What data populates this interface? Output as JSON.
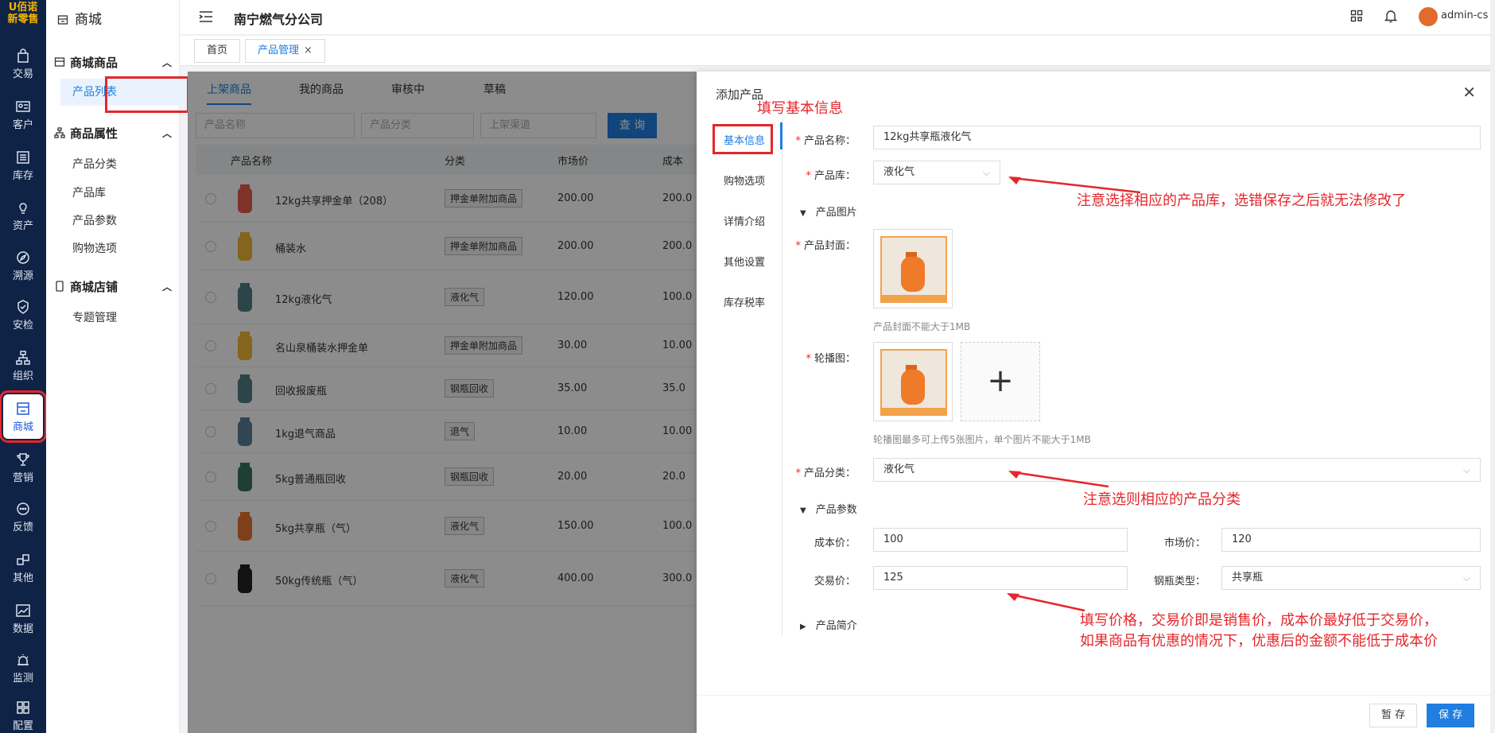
{
  "rail": {
    "logo_line1": "U佰诺",
    "logo_line2": "新零售",
    "items": [
      {
        "label": "交易",
        "icon": "bag-icon"
      },
      {
        "label": "客户",
        "icon": "id-card-icon"
      },
      {
        "label": "库存",
        "icon": "list-icon"
      },
      {
        "label": "资产",
        "icon": "bulb-icon"
      },
      {
        "label": "溯源",
        "icon": "compass-icon"
      },
      {
        "label": "安检",
        "icon": "shield-check-icon"
      },
      {
        "label": "组织",
        "icon": "org-icon"
      },
      {
        "label": "商城",
        "icon": "store-icon"
      },
      {
        "label": "营销",
        "icon": "trophy-icon"
      },
      {
        "label": "反馈",
        "icon": "chat-icon"
      },
      {
        "label": "其他",
        "icon": "blocks-icon"
      },
      {
        "label": "数据",
        "icon": "chart-icon"
      },
      {
        "label": "监测",
        "icon": "alarm-icon"
      },
      {
        "label": "配置",
        "icon": "grid-icon"
      }
    ]
  },
  "sidebar": {
    "title": "商城",
    "groups": [
      {
        "label": "商城商品",
        "items": [
          "产品列表"
        ]
      },
      {
        "label": "商品属性",
        "items": [
          "产品分类",
          "产品库",
          "产品参数",
          "购物选项"
        ]
      },
      {
        "label": "商城店铺",
        "items": [
          "专题管理"
        ]
      }
    ]
  },
  "topbar": {
    "company": "南宁燃气分公司",
    "user": "admin-cs"
  },
  "tabs": [
    {
      "label": "首页"
    },
    {
      "label": "产品管理"
    }
  ],
  "list": {
    "tabs": [
      "上架商品",
      "我的商品",
      "审核中",
      "草稿"
    ],
    "filters": {
      "name_ph": "产品名称",
      "category_ph": "产品分类",
      "channel_ph": "上架渠道",
      "query": "查 询"
    },
    "columns": [
      "产品名称",
      "分类",
      "市场价",
      "成本"
    ],
    "rows": [
      {
        "name": "12kg共享押金单（208）",
        "category": "押金单附加商品",
        "price": "200.00",
        "cost": "200.0"
      },
      {
        "name": "桶装水",
        "category": "押金单附加商品",
        "price": "200.00",
        "cost": "200.0"
      },
      {
        "name": "12kg液化气",
        "category": "液化气",
        "price": "120.00",
        "cost": "100.0"
      },
      {
        "name": "名山泉桶装水押金单",
        "category": "押金单附加商品",
        "price": "30.00",
        "cost": "10.00"
      },
      {
        "name": "回收报废瓶",
        "category": "钢瓶回收",
        "price": "35.00",
        "cost": "35.0"
      },
      {
        "name": "1kg退气商品",
        "category": "退气",
        "price": "10.00",
        "cost": "10.00"
      },
      {
        "name": "5kg普通瓶回收",
        "category": "钢瓶回收",
        "price": "20.00",
        "cost": "20.0"
      },
      {
        "name": "5kg共享瓶（气）",
        "category": "液化气",
        "price": "150.00",
        "cost": "100.0"
      },
      {
        "name": "50kg传统瓶（气）",
        "category": "液化气",
        "price": "400.00",
        "cost": "300.0"
      }
    ]
  },
  "drawer": {
    "title": "添加产品",
    "nav": [
      "基本信息",
      "购物选项",
      "详情介绍",
      "其他设置",
      "库存税率"
    ],
    "fields": {
      "name_label": "产品名称：",
      "name_value": "12kg共享瓶液化气",
      "library_label": "产品库：",
      "library_value": "液化气",
      "images_section": "产品图片",
      "cover_label": "产品封面：",
      "cover_hint": "产品封面不能大于1MB",
      "carousel_label": "轮播图：",
      "carousel_hint": "轮播图最多可上传5张图片，单个图片不能大于1MB",
      "category_label": "产品分类：",
      "category_value": "液化气",
      "params_section": "产品参数",
      "cost_label": "成本价：",
      "cost_value": "100",
      "market_label": "市场价：",
      "market_value": "120",
      "trade_label": "交易价：",
      "trade_value": "125",
      "cylinder_label": "钢瓶类型：",
      "cylinder_value": "共享瓶",
      "intro_section": "产品简介"
    },
    "buttons": {
      "draft": "暂 存",
      "save": "保 存"
    }
  },
  "annotations": {
    "a1": "填写基本信息",
    "a2": "注意选择相应的产品库，选错保存之后就无法修改了",
    "a3": "注意选则相应的产品分类",
    "a4_line1": "填写价格，交易价即是销售价，成本价最好低于交易价，",
    "a4_line2": "如果商品有优惠的情况下，优惠后的金额不能低于成本价"
  },
  "colors": {
    "accent": "#1f7ee0",
    "rail": "#0f2346",
    "annotation": "#e5262a"
  }
}
